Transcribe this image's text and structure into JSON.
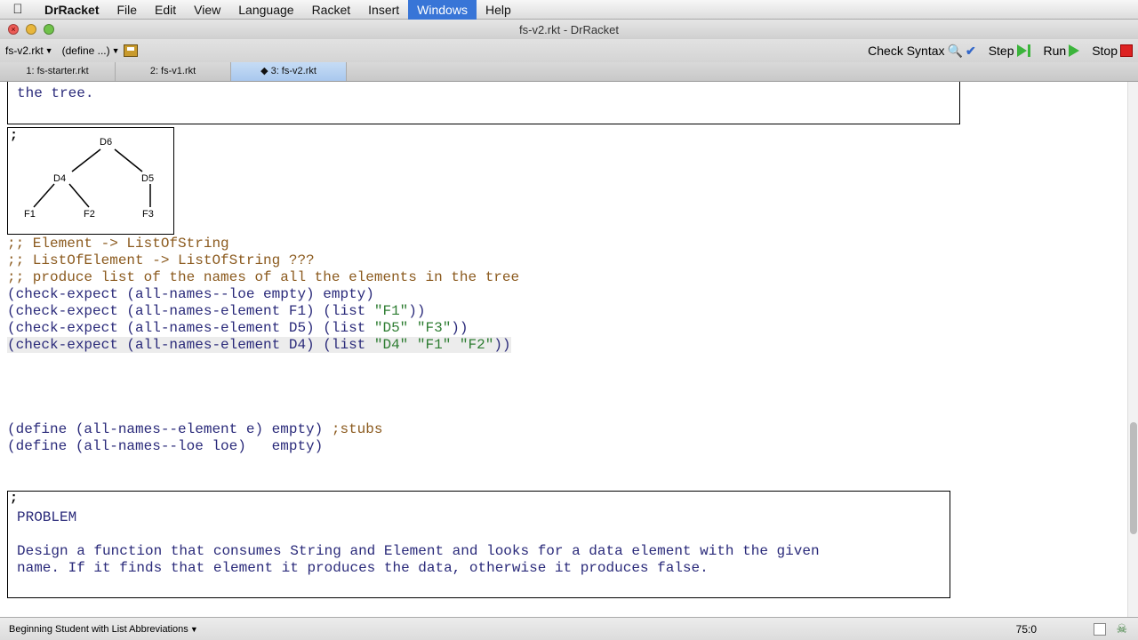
{
  "menubar": {
    "app": "DrRacket",
    "items": [
      "File",
      "Edit",
      "View",
      "Language",
      "Racket",
      "Insert",
      "Windows",
      "Help"
    ]
  },
  "window": {
    "title": "fs-v2.rkt - DrRacket"
  },
  "toolbar": {
    "file_menu": "fs-v2.rkt",
    "define_menu": "(define ...)",
    "check_syntax": "Check Syntax",
    "step": "Step",
    "run": "Run",
    "stop": "Stop"
  },
  "tabs": [
    "1: fs-starter.rkt",
    "2: fs-v1.rkt",
    "◆ 3: fs-v2.rkt"
  ],
  "editor": {
    "box1_text": "the tree.",
    "tree_nodes": [
      "D6",
      "D4",
      "D5",
      "F1",
      "F2",
      "F3"
    ],
    "lines": {
      "c1": ";; Element -> ListOfString",
      "c2": ";; ListOfElement -> ListOfString ???",
      "c3": ";; produce list of the names of all the elements in the tree",
      "l1": "(check-expect (all-names--loe empty) empty)",
      "l2a": "(check-expect (all-names-element F1) (list ",
      "l2s": "\"F1\"",
      "l2b": "))",
      "l3a": "(check-expect (all-names-element D5) (list ",
      "l3s1": "\"D5\"",
      "l3s2": "\"F3\"",
      "l3b": "))",
      "l4a": "(check-expect (all-names-element D4) (list ",
      "l4s1": "\"D4\"",
      "l4s2": "\"F1\"",
      "l4s3": "\"F2\"",
      "l4b": "))",
      "d1": "(define (all-names--element e) empty) ",
      "d1c": ";stubs",
      "d2": "(define (all-names--loe loe)   empty)"
    },
    "problem_title": "PROBLEM",
    "problem_l1": "Design a function that consumes String and Element and looks for a data element with the given",
    "problem_l2": "name. If it finds that element it produces the data, otherwise it produces false."
  },
  "status": {
    "language": "Beginning Student with List Abbreviations",
    "position": "75:0"
  }
}
